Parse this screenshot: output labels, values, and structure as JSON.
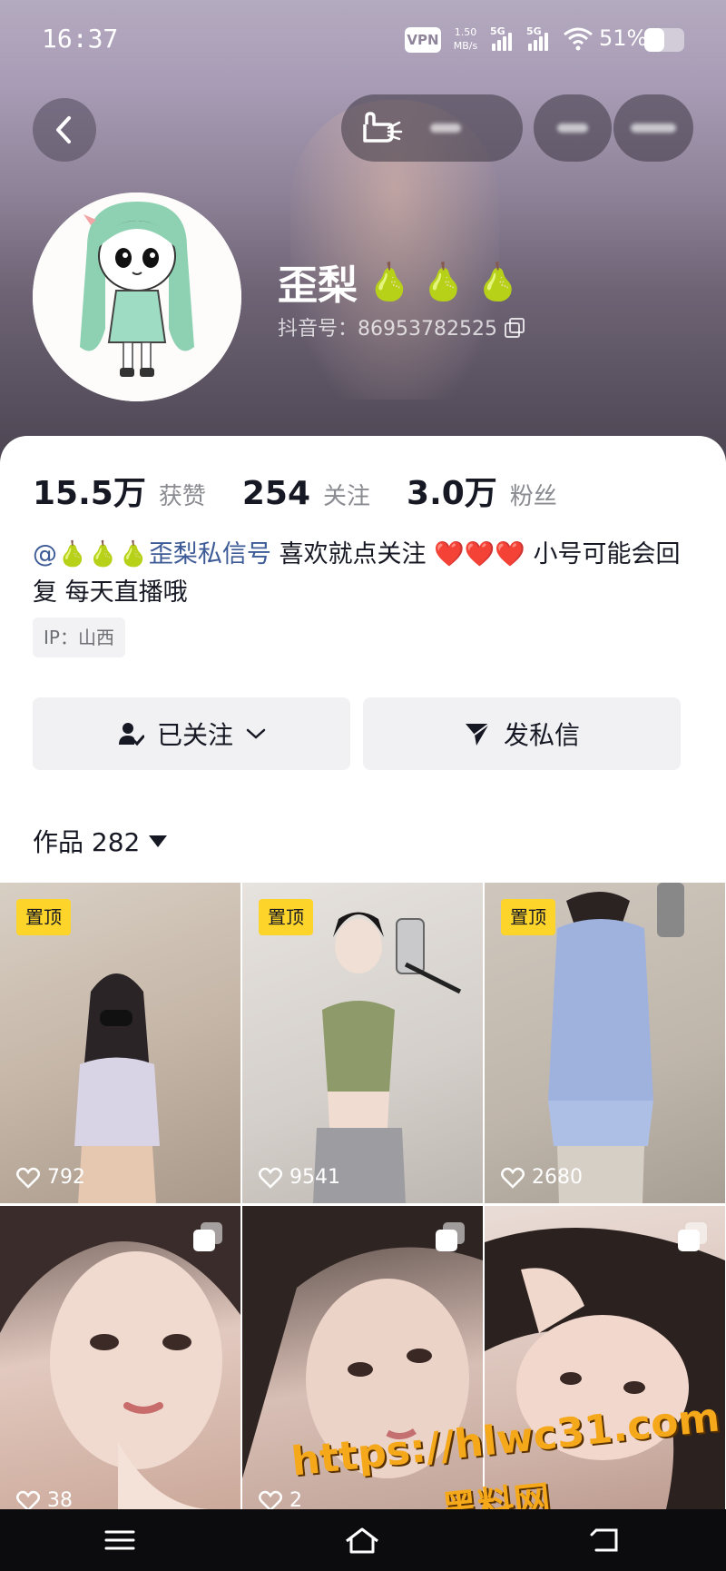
{
  "status_bar": {
    "time": "16:37",
    "vpn": "VPN",
    "net_speed": "1.50\nMB/s",
    "signal1": "5G",
    "signal2": "5G",
    "battery_text": "51%",
    "battery_level": 0.51
  },
  "profile": {
    "nickname": "歪梨",
    "nickname_emojis": [
      "🍐",
      "🍐",
      "🍐"
    ],
    "douyin_id": "抖音号：86953782525"
  },
  "stats": [
    {
      "num": "15.5万",
      "label": "获赞"
    },
    {
      "num": "254",
      "label": "关注"
    },
    {
      "num": "3.0万",
      "label": "粉丝"
    }
  ],
  "bio": {
    "mention": "@🍐🍐🍐歪梨私信号",
    "text1": " 喜欢就点关注 ",
    "hearts": "❤️❤️❤️",
    "text2": " 小号可能会回复  每天直播哦"
  },
  "ip": "IP：山西",
  "buttons": {
    "follow": "已关注",
    "message": "发私信"
  },
  "works_tab": "作品 282",
  "grid": [
    {
      "pinned": "置顶",
      "likes": "792"
    },
    {
      "pinned": "置顶",
      "likes": "9541"
    },
    {
      "pinned": "置顶",
      "likes": "2680"
    },
    {
      "pinned": "",
      "likes": "38"
    },
    {
      "pinned": "",
      "likes": "2"
    },
    {
      "pinned": "",
      "likes": ""
    }
  ],
  "watermark": {
    "url": "https://hlwc31.com",
    "name": "黑料网"
  },
  "colors": {
    "pin": "#fdd42a",
    "mention": "#3c5a96",
    "watermark": "#f5a81a"
  }
}
